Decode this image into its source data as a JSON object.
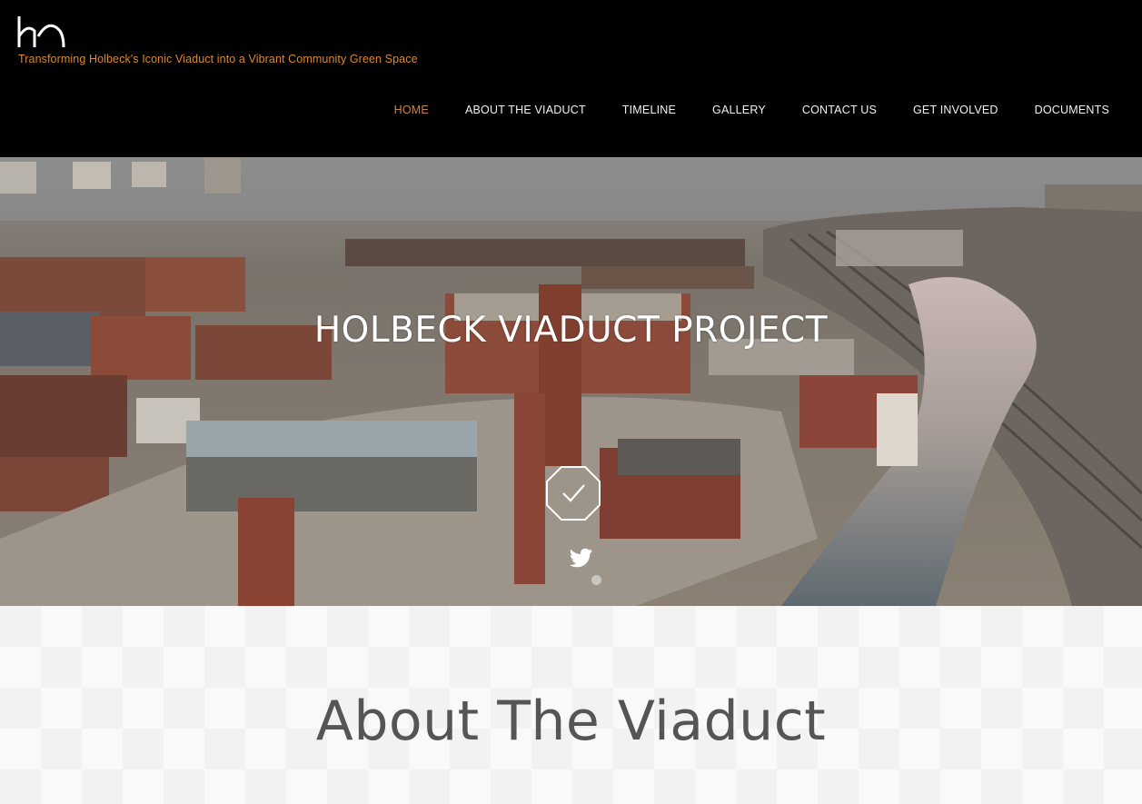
{
  "header": {
    "logo_text": "hh",
    "tagline": "Transforming Holbeck's Iconic Viaduct into a Vibrant Community Green Space",
    "nav": [
      {
        "label": "HOME",
        "active": true
      },
      {
        "label": "ABOUT THE VIADUCT",
        "active": false
      },
      {
        "label": "TIMELINE",
        "active": false
      },
      {
        "label": "GALLERY",
        "active": false
      },
      {
        "label": "CONTACT US",
        "active": false
      },
      {
        "label": "GET INVOLVED",
        "active": false
      },
      {
        "label": "DOCUMENTS",
        "active": false
      }
    ]
  },
  "hero": {
    "title": "HOLBECK VIADUCT PROJECT",
    "check_icon": "check-hexagon-icon",
    "twitter_icon": "twitter-bird-icon",
    "slider_dot_icon": "slider-dot"
  },
  "about": {
    "heading": "About The Viaduct"
  },
  "colors": {
    "header_bg": "#000000",
    "tagline": "#d98a2b",
    "nav_active": "#c8874a",
    "nav_text": "#f2f2f2",
    "about_bg": "#f2f2f2",
    "about_heading": "#555555"
  }
}
